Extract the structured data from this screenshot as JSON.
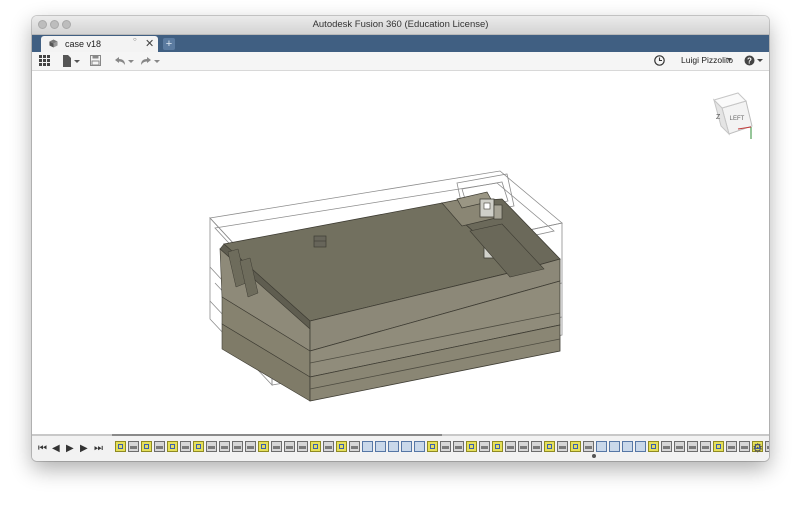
{
  "window": {
    "title": "Autodesk Fusion 360 (Education License)"
  },
  "tabs": [
    {
      "label": "case v18",
      "active": true
    }
  ],
  "toolbar": {
    "user_name": "Luigi Pizzolito"
  },
  "viewcube": {
    "axis_label": "Z",
    "face_label": "LEFT"
  },
  "icons": {
    "grid": "app-grid-icon",
    "file": "file-icon",
    "save": "save-icon",
    "undo": "undo-icon",
    "redo": "redo-icon",
    "clock": "clock-icon",
    "help": "help-icon",
    "gear": "gear-icon"
  },
  "timeline": {
    "controls": [
      "⏮",
      "◀",
      "▶",
      "▶",
      "⏭"
    ],
    "features": [
      "sketch",
      "feat",
      "sketch",
      "feat",
      "sketch",
      "feat",
      "sketch",
      "feat",
      "feat",
      "feat",
      "feat",
      "sketch",
      "feat",
      "feat",
      "feat",
      "sketch",
      "feat",
      "sketch",
      "feat",
      "construct",
      "construct",
      "construct",
      "construct",
      "construct",
      "sketch",
      "feat",
      "feat",
      "sketch",
      "feat",
      "sketch",
      "feat",
      "feat",
      "feat",
      "sketch",
      "feat",
      "sketch",
      "feat",
      "construct",
      "construct",
      "construct",
      "construct",
      "sketch",
      "feat",
      "feat",
      "feat",
      "feat",
      "sketch",
      "feat",
      "feat",
      "sketch",
      "feat",
      "feat"
    ]
  },
  "colors": {
    "tab_bar": "#405f82",
    "model_top": "#75705f",
    "model_side": "#8c8776"
  }
}
